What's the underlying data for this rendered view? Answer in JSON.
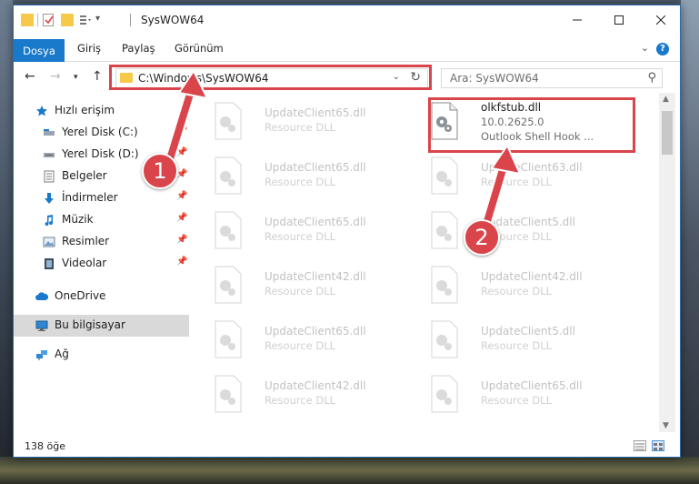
{
  "window": {
    "title": "SysWOW64"
  },
  "ribbon": {
    "tabs": [
      "Dosya",
      "Giriş",
      "Paylaş",
      "Görünüm"
    ]
  },
  "nav": {
    "address": "C:\\Windows\\SysWOW64",
    "search_placeholder": "Ara: SysWOW64"
  },
  "sidebar": {
    "items": [
      {
        "label": "Hızlı erişim",
        "icon": "star-icon"
      },
      {
        "label": "Yerel Disk (C:)",
        "icon": "drive-icon"
      },
      {
        "label": "Yerel Disk (D:)",
        "icon": "drive-icon"
      },
      {
        "label": "Belgeler",
        "icon": "documents-icon"
      },
      {
        "label": "İndirmeler",
        "icon": "download-icon"
      },
      {
        "label": "Müzik",
        "icon": "music-icon"
      },
      {
        "label": "Resimler",
        "icon": "pictures-icon"
      },
      {
        "label": "Videolar",
        "icon": "videos-icon"
      },
      {
        "label": "OneDrive",
        "icon": "cloud-icon"
      },
      {
        "label": "Bu bilgisayar",
        "icon": "computer-icon"
      },
      {
        "label": "Ağ",
        "icon": "network-icon"
      }
    ]
  },
  "files": {
    "left": [
      {
        "name": "UpdateClient65.dll",
        "type": "Resource DLL"
      },
      {
        "name": "UpdateClient65.dll",
        "type": "Resource DLL"
      },
      {
        "name": "UpdateClient65.dll",
        "type": "Resource DLL"
      },
      {
        "name": "UpdateClient42.dll",
        "type": "Resource DLL"
      },
      {
        "name": "UpdateClient65.dll",
        "type": "Resource DLL"
      },
      {
        "name": "UpdateClient42.dll",
        "type": "Resource DLL"
      }
    ],
    "right": [
      {
        "name": "olkfstub.dll",
        "version": "10.0.2625.0",
        "type": "Outlook Shell Hook ..."
      },
      {
        "name": "UpdateClient63.dll",
        "type": "Resource DLL"
      },
      {
        "name": "UpdateClient5.dll",
        "type": "Resource DLL"
      },
      {
        "name": "UpdateClient42.dll",
        "type": "Resource DLL"
      },
      {
        "name": "UpdateClient5.dll",
        "type": "Resource DLL"
      },
      {
        "name": "UpdateClient65.dll",
        "type": "Resource DLL"
      }
    ]
  },
  "status": {
    "count": "138 öğe"
  },
  "annotations": {
    "step1": "1",
    "step2": "2",
    "color": "#d9454a"
  }
}
